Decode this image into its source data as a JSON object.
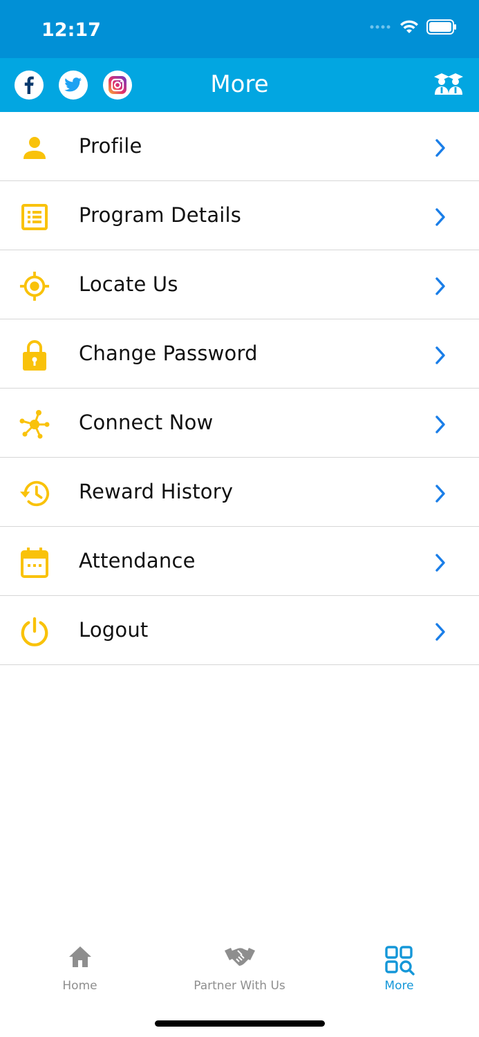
{
  "status": {
    "time": "12:17"
  },
  "header": {
    "title": "More"
  },
  "menu": {
    "items": [
      {
        "label": "Profile",
        "icon": "person-icon"
      },
      {
        "label": "Program Details",
        "icon": "list-icon"
      },
      {
        "label": "Locate Us",
        "icon": "target-icon"
      },
      {
        "label": "Change Password",
        "icon": "lock-icon"
      },
      {
        "label": "Connect Now",
        "icon": "network-icon"
      },
      {
        "label": "Reward History",
        "icon": "history-icon"
      },
      {
        "label": "Attendance",
        "icon": "calendar-icon"
      },
      {
        "label": "Logout",
        "icon": "power-icon"
      }
    ]
  },
  "tabs": [
    {
      "label": "Home",
      "icon": "home-icon",
      "active": false
    },
    {
      "label": "Partner With Us",
      "icon": "handshake-icon",
      "active": false
    },
    {
      "label": "More",
      "icon": "grid-search-icon",
      "active": true
    }
  ],
  "colors": {
    "status_bar": "#0190d6",
    "nav_bar": "#02a6e1",
    "icon_yellow": "#f9c20a",
    "chevron_blue": "#1a7ee8",
    "tab_active": "#1597d8",
    "tab_inactive": "#8e8e8e"
  }
}
